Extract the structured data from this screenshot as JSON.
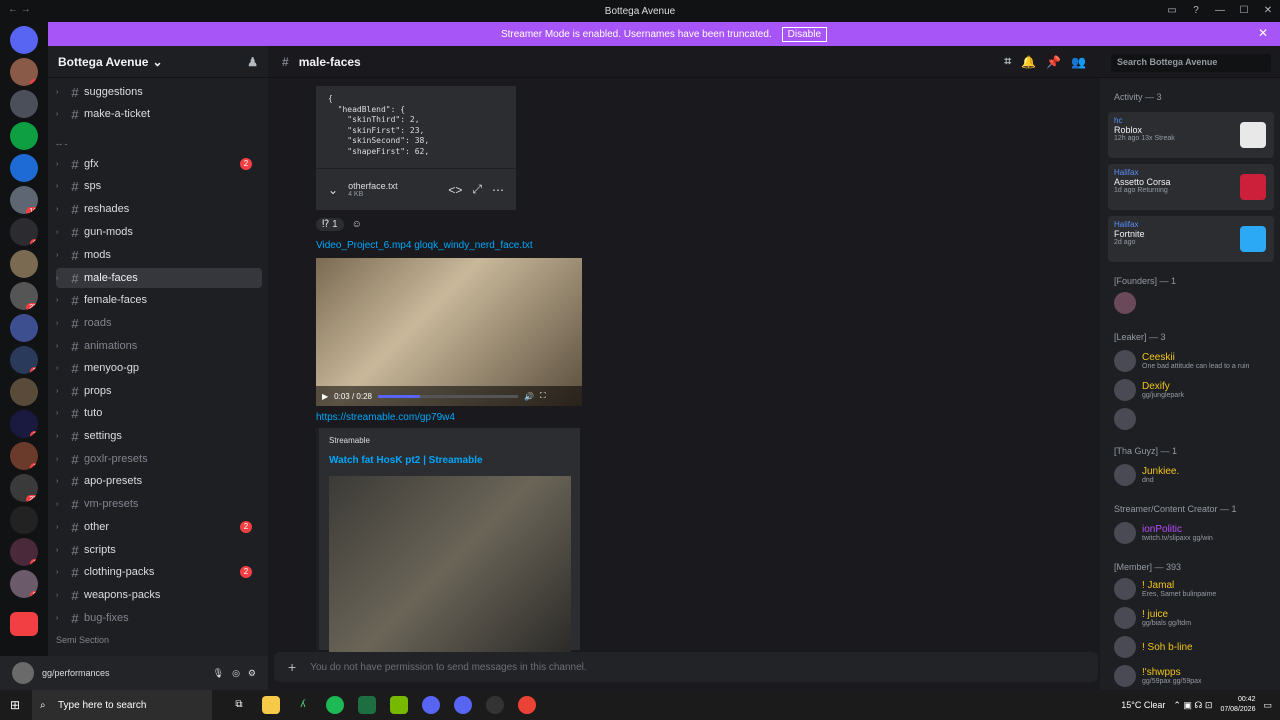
{
  "window": {
    "title": "Bottega Avenue",
    "back": "←  →"
  },
  "banner": {
    "text": "Streamer Mode is enabled. Usernames have been truncated.",
    "button": "Disable"
  },
  "guild": {
    "name": "Bottega Avenue",
    "semi_section": "Semi Section",
    "dash": "-- -"
  },
  "channels": [
    {
      "name": "suggestions",
      "muted": false
    },
    {
      "name": "make-a-ticket",
      "muted": false
    },
    {
      "name": "gfx",
      "muted": false,
      "badge": "2"
    },
    {
      "name": "sps",
      "muted": false
    },
    {
      "name": "reshades",
      "muted": false
    },
    {
      "name": "gun-mods",
      "muted": false
    },
    {
      "name": "mods",
      "muted": false
    },
    {
      "name": "male-faces",
      "muted": false,
      "selected": true
    },
    {
      "name": "female-faces",
      "muted": false
    },
    {
      "name": "roads",
      "muted": true
    },
    {
      "name": "animations",
      "muted": true
    },
    {
      "name": "menyoo-gp",
      "muted": false
    },
    {
      "name": "props",
      "muted": false
    },
    {
      "name": "tuto",
      "muted": false
    },
    {
      "name": "settings",
      "muted": false
    },
    {
      "name": "goxlr-presets",
      "muted": true
    },
    {
      "name": "apo-presets",
      "muted": false
    },
    {
      "name": "vm-presets",
      "muted": true
    },
    {
      "name": "other",
      "muted": false,
      "badge": "2"
    },
    {
      "name": "scripts",
      "muted": false
    },
    {
      "name": "clothing-packs",
      "muted": false,
      "badge": "2"
    },
    {
      "name": "weapons-packs",
      "muted": false
    },
    {
      "name": "bug-fixes",
      "muted": true
    }
  ],
  "user": {
    "status": "gg/performances"
  },
  "channel_header": {
    "name": "male-faces",
    "search_placeholder": "Search Bottega Avenue"
  },
  "messages": {
    "code": "{\n  \"headBlend\": {\n    \"skinThird\": 2,\n    \"skinFirst\": 23,\n    \"skinSecond\": 38,\n    \"shapeFirst\": 62,",
    "attachment_name": "otherface.txt",
    "attachment_size": "4 KB",
    "reaction_count": "1",
    "file_links": "Video_Project_6.mp4  gloqk_windy_nerd_face.txt",
    "video_time": "0:03 / 0:28",
    "url": "https://streamable.com/gp79w4",
    "embed_provider": "Streamable",
    "embed_title": "Watch fat HosK pt2 | Streamable"
  },
  "input": {
    "placeholder": "You do not have permission to send messages in this channel."
  },
  "members": {
    "activity_header": "Activity — 3",
    "activities": [
      {
        "user": "hc",
        "game": "Roblox",
        "time": "12h ago",
        "extra": "13x Streak"
      },
      {
        "user": "Halifax",
        "game": "Assetto Corsa",
        "time": "1d ago",
        "extra": "Returning"
      },
      {
        "user": "Halifax",
        "game": "Fortnite",
        "time": "2d ago",
        "extra": ""
      }
    ],
    "founders_header": "[Founders] — 1",
    "leaker_header": "[Leaker] — 3",
    "leakers": [
      {
        "name": "Ceeskii",
        "sub": "One bad attitude can lead to a ruin"
      },
      {
        "name": "Dexify",
        "sub": "gg/junglepark"
      },
      {
        "name": "",
        "sub": ""
      }
    ],
    "guyz_header": "[Tha Guyz] — 1",
    "guyz": [
      {
        "name": "Junkiee.",
        "sub": "dnd"
      }
    ],
    "streamer_header": "Streamer/Content Creator — 1",
    "streamers": [
      {
        "name": "ionPolitic",
        "sub": "twitch.tv/slipaxx gg/win"
      }
    ],
    "member_header": "[Member] — 393",
    "member_list": [
      {
        "name": "! Jamal",
        "sub": "Eres, Samet bulinpaime"
      },
      {
        "name": "! juice",
        "sub": "gg/bials gg/ltdm"
      },
      {
        "name": "! Soh b-line",
        "sub": ""
      },
      {
        "name": "!'shwpps",
        "sub": "gg/59pax gg/59pax"
      }
    ]
  },
  "taskbar": {
    "search": "Type here to search",
    "weather": "15°C  Clear",
    "time": "00:42",
    "date": "07/08/2026"
  },
  "colors": {
    "accent": "#a855f7",
    "link": "#00a8fc",
    "badge": "#f23f43"
  }
}
